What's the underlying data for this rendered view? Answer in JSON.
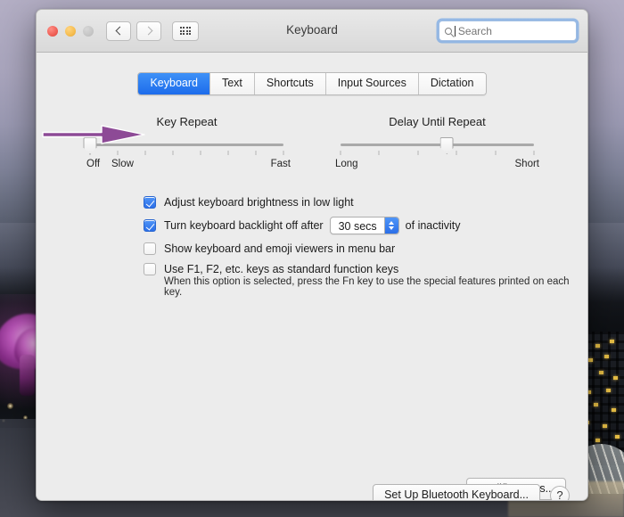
{
  "window": {
    "title": "Keyboard",
    "traffic_lights": [
      "close-red",
      "minimize-yellow",
      "zoom-disabled-gray"
    ],
    "nav": {
      "back": "back-chevron",
      "forward": "forward-chevron",
      "show_all": "show-all-grid"
    }
  },
  "search": {
    "placeholder": "Search",
    "value": "",
    "icon": "search-icon",
    "focused": true,
    "focus_ring_color": "#5696e6"
  },
  "tabs": [
    {
      "label": "Keyboard",
      "active": true
    },
    {
      "label": "Text",
      "active": false
    },
    {
      "label": "Shortcuts",
      "active": false
    },
    {
      "label": "Input Sources",
      "active": false
    },
    {
      "label": "Dictation",
      "active": false
    }
  ],
  "sliders": [
    {
      "title": "Key Repeat",
      "left_label": "Off",
      "second_label": "Slow",
      "right_label": "Fast",
      "tick_count": 8,
      "value_index": 0,
      "value_percent": 0
    },
    {
      "title": "Delay Until Repeat",
      "left_label": "Long",
      "right_label": "Short",
      "tick_count": 6,
      "value_index": 3,
      "value_percent": 55
    }
  ],
  "options": [
    {
      "id": "adjust-brightness",
      "checked": true,
      "label": "Adjust keyboard brightness in low light"
    },
    {
      "id": "backlight-off",
      "checked": true,
      "label_before": "Turn keyboard backlight off after",
      "stepper_value": "30 secs",
      "label_after": "of inactivity"
    },
    {
      "id": "show-viewers",
      "checked": false,
      "label": "Show keyboard and emoji viewers in menu bar"
    },
    {
      "id": "function-keys",
      "checked": false,
      "label": "Use F1, F2, etc. keys as standard function keys",
      "help": "When this option is selected, press the Fn key to use the special features printed on each key."
    }
  ],
  "buttons": {
    "modifier_keys": "Modifier Keys...",
    "bluetooth_keyboard": "Set Up Bluetooth Keyboard...",
    "help": "?"
  },
  "annotation": {
    "type": "arrow",
    "color": "#8d4a96",
    "points_to": "key-repeat-slider-thumb"
  },
  "colors": {
    "accent_blue": "#2b6fe8",
    "window_bg": "#ececec",
    "titlebar_top": "#e9e9e9",
    "titlebar_bottom": "#d9d9d9"
  }
}
